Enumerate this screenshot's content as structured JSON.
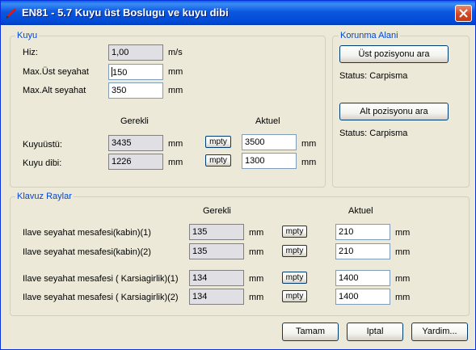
{
  "window": {
    "title": "EN81 - 5.7 Kuyu üst Boslugu ve kuyu dibi",
    "close_icon": "close-x-icon",
    "app_icon": "pen-icon"
  },
  "kuyu": {
    "legend": "Kuyu",
    "hiz_label": "Hiz:",
    "hiz_value": "1,00",
    "hiz_unit": "m/s",
    "max_ust_label": "Max.Üst seyahat",
    "max_ust_value": "150",
    "max_ust_unit": "mm",
    "max_alt_label": "Max.Alt seyahat",
    "max_alt_value": "350",
    "max_alt_unit": "mm",
    "gerekli_header": "Gerekli",
    "aktuel_header": "Aktuel",
    "rows": [
      {
        "label": "Kuyuüstü:",
        "gerekli": "3435",
        "unit1": "mm",
        "button": "mpty",
        "aktuel": "3500",
        "unit2": "mm"
      },
      {
        "label": "Kuyu dibi:",
        "gerekli": "1226",
        "unit1": "mm",
        "button": "mpty",
        "aktuel": "1300",
        "unit2": "mm"
      }
    ]
  },
  "korunma": {
    "legend": "Korunma Alani",
    "ust_button": "Üst pozisyonu ara",
    "ust_status": "Status: Carpisma",
    "alt_button": "Alt pozisyonu ara",
    "alt_status": "Status: Carpisma"
  },
  "klavuz": {
    "legend": "Klavuz Raylar",
    "gerekli_header": "Gerekli",
    "aktuel_header": "Aktuel",
    "rows": [
      {
        "label": "Ilave seyahat mesafesi(kabin)(1)",
        "gerekli": "135",
        "unit1": "mm",
        "button": "mpty",
        "aktuel": "210",
        "unit2": "mm"
      },
      {
        "label": "Ilave seyahat mesafesi(kabin)(2)",
        "gerekli": "135",
        "unit1": "mm",
        "button": "mpty",
        "aktuel": "210",
        "unit2": "mm"
      },
      {
        "label": "Ilave seyahat mesafesi ( Karsiagirlik)(1)",
        "gerekli": "134",
        "unit1": "mm",
        "button": "mpty",
        "aktuel": "1400",
        "unit2": "mm"
      },
      {
        "label": "Ilave seyahat mesafesi ( Karsiagirlik)(2)",
        "gerekli": "134",
        "unit1": "mm",
        "button": "mpty",
        "aktuel": "1400",
        "unit2": "mm"
      }
    ]
  },
  "footer": {
    "ok_label": "Tamam",
    "cancel_label": "Iptal",
    "help_label": "Yardim..."
  }
}
